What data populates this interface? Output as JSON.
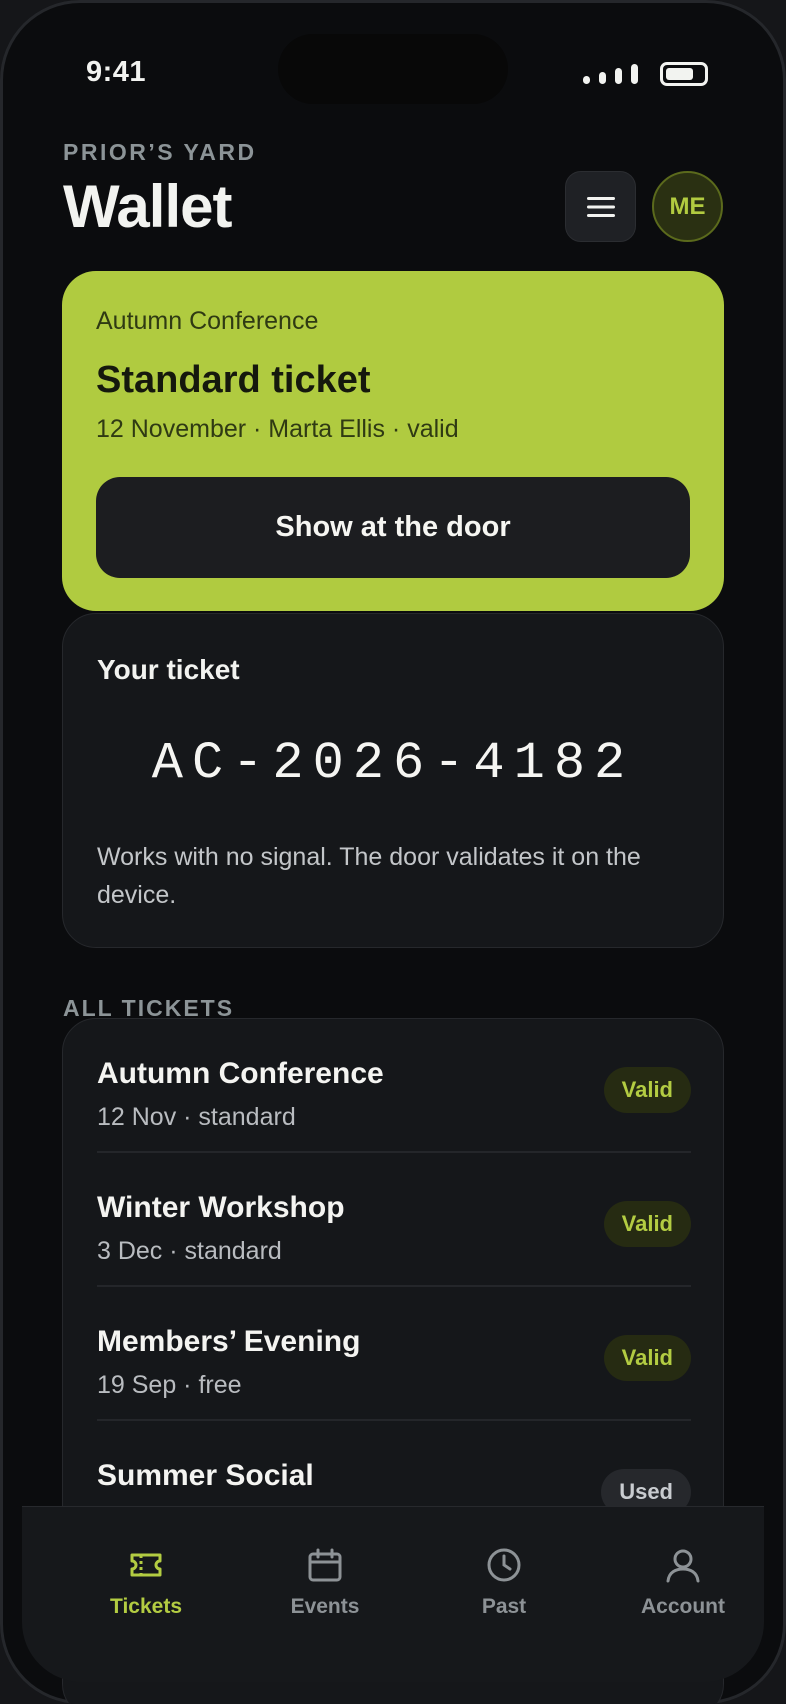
{
  "status": {
    "time": "9:41",
    "battery_level": 0.75
  },
  "header": {
    "overline": "PRIOR’S YARD",
    "title": "Wallet",
    "avatar_initials": "ME"
  },
  "hero": {
    "event": "Autumn Conference",
    "ticket_type": "Standard ticket",
    "meta": "12 November · Marta Ellis · valid",
    "button_label": "Show at the door"
  },
  "code_card": {
    "title": "Your ticket",
    "code": "AC-2026-4182",
    "note": "Works with no signal. The door validates it on the device."
  },
  "all_tickets": {
    "label": "ALL TICKETS",
    "items": [
      {
        "name": "Autumn Conference",
        "meta": "12 Nov · standard",
        "status": "Valid"
      },
      {
        "name": "Winter Workshop",
        "meta": "3 Dec · standard",
        "status": "Valid"
      },
      {
        "name": "Members’ Evening",
        "meta": "19 Sep · free",
        "status": "Valid"
      },
      {
        "name": "Summer Social",
        "meta": "",
        "status": "Used"
      }
    ]
  },
  "tabbar": {
    "tabs": [
      {
        "label": "Tickets",
        "icon": "ticket-icon",
        "active": true
      },
      {
        "label": "Events",
        "icon": "calendar-icon",
        "active": false
      },
      {
        "label": "Past",
        "icon": "clock-icon",
        "active": false
      },
      {
        "label": "Account",
        "icon": "user-icon",
        "active": false
      }
    ]
  },
  "colors": {
    "accent": "#b0cb40",
    "background": "#0b0c0e",
    "card": "#15171a"
  }
}
